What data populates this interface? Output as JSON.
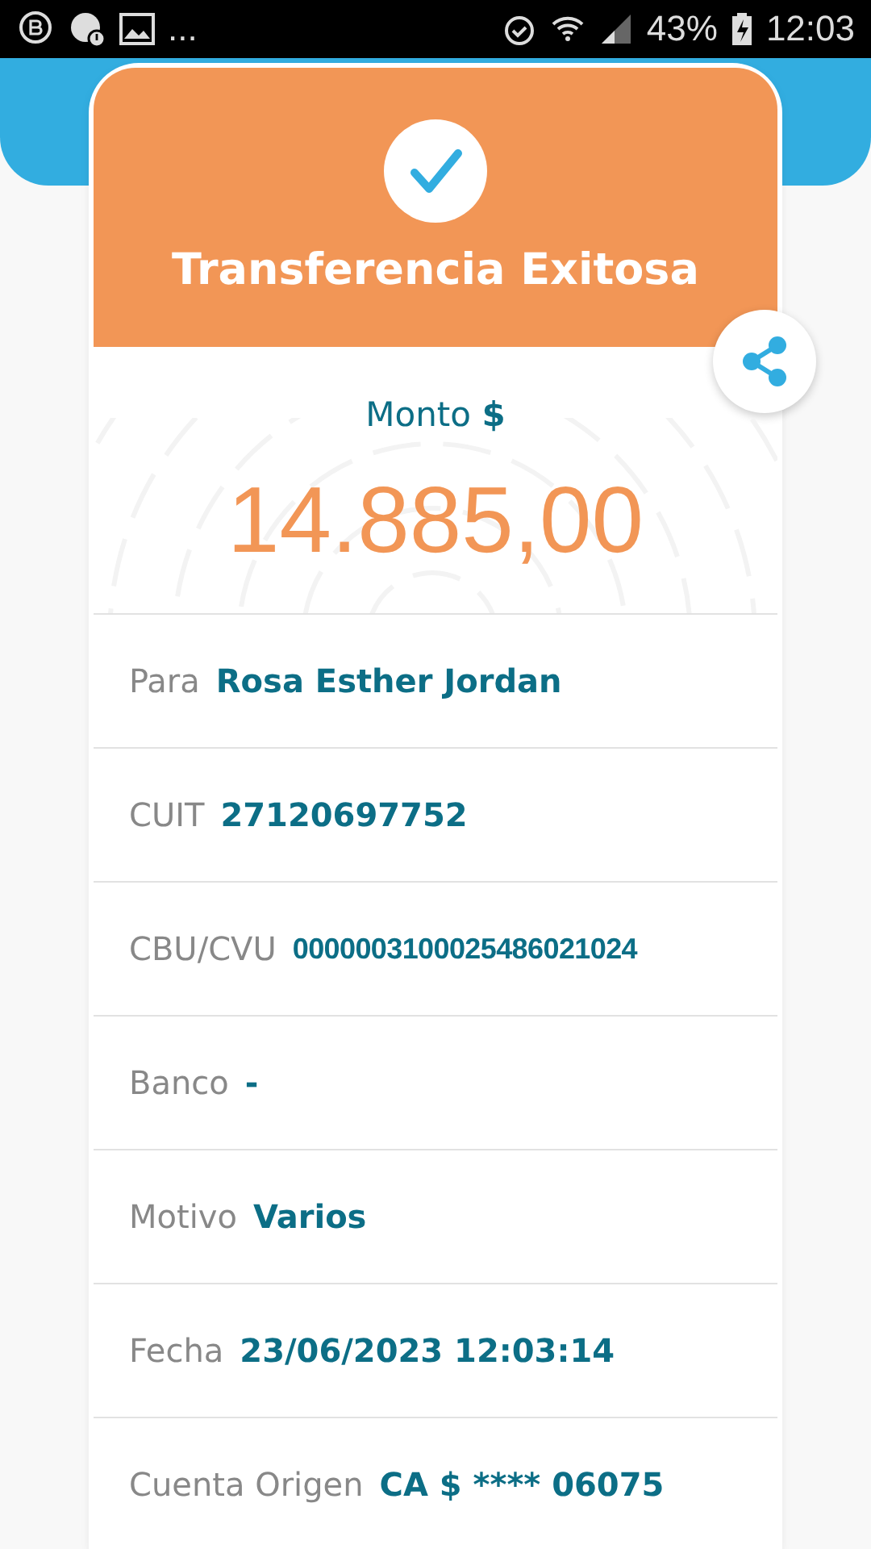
{
  "status_bar": {
    "overflow": "...",
    "battery": "43%",
    "time": "12:03"
  },
  "header": {
    "title": "Transferencia Exitosa"
  },
  "amount": {
    "label": "Monto **$**",
    "value": "14.885,00"
  },
  "details": [
    {
      "label": "Para",
      "value": "Rosa Esther Jordan"
    },
    {
      "label": "CUIT",
      "value": "27120697752"
    },
    {
      "label": "CBU/CVU",
      "value": "0000003100025486021024"
    },
    {
      "label": "Banco",
      "value": "-"
    },
    {
      "label": "Motivo",
      "value": "Varios"
    },
    {
      "label": "Fecha",
      "value": "23/06/2023 12:03:14"
    },
    {
      "label": "Cuenta Origen",
      "value": "CA $ **** 06075"
    }
  ]
}
